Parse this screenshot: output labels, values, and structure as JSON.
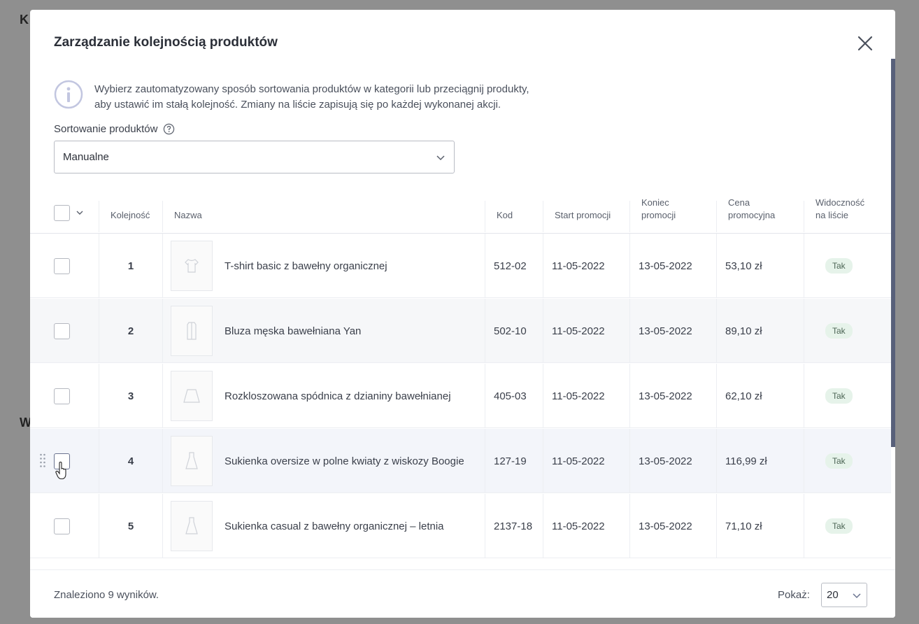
{
  "background": {
    "fragment_top": "K",
    "fragment_mid": "W"
  },
  "modal": {
    "title": "Zarządzanie kolejnością produktów",
    "info_line1": "Wybierz zautomatyzowany sposób sortowania produktów w kategorii lub przeciągnij produkty,",
    "info_line2": "aby ustawić im stałą kolejność. Zmiany na liście zapisują się po każdej wykonanej akcji.",
    "sort_label": "Sortowanie produktów",
    "sort_value": "Manualne"
  },
  "table": {
    "headers": {
      "order": "Kolejność",
      "name": "Nazwa",
      "code": "Kod",
      "start": "Start promocji",
      "end_l1": "Koniec",
      "end_l2": "promocji",
      "price_l1": "Cena",
      "price_l2": "promocyjna",
      "vis_l1": "Widoczność",
      "vis_l2": "na liście"
    },
    "rows": [
      {
        "order": "1",
        "name": "T-shirt basic z bawełny organicznej",
        "code": "512-02",
        "start": "11-05-2022",
        "end": "13-05-2022",
        "price": "53,10 zł",
        "visibility": "Tak",
        "icon": "tshirt-icon"
      },
      {
        "order": "2",
        "name": "Bluza męska bawełniana Yan",
        "code": "502-10",
        "start": "11-05-2022",
        "end": "13-05-2022",
        "price": "89,10 zł",
        "visibility": "Tak",
        "icon": "hoodie-icon"
      },
      {
        "order": "3",
        "name": "Rozkloszowana spódnica z dzianiny bawełnianej",
        "code": "405-03",
        "start": "11-05-2022",
        "end": "13-05-2022",
        "price": "62,10 zł",
        "visibility": "Tak",
        "icon": "skirt-icon"
      },
      {
        "order": "4",
        "name": "Sukienka oversize w polne kwiaty z wiskozy Boogie",
        "code": "127-19",
        "start": "11-05-2022",
        "end": "13-05-2022",
        "price": "116,99 zł",
        "visibility": "Tak",
        "icon": "dress-icon"
      },
      {
        "order": "5",
        "name": "Sukienka casual z bawełny organicznej – letnia",
        "code": "2137-18",
        "start": "11-05-2022",
        "end": "13-05-2022",
        "price": "71,10 zł",
        "visibility": "Tak",
        "icon": "dress-icon"
      }
    ]
  },
  "footer": {
    "found": "Znaleziono 9 wyników.",
    "show_label": "Pokaż:",
    "page_size": "20"
  },
  "colors": {
    "accent": "#58607a",
    "badge_bg": "#e6f3ea"
  }
}
